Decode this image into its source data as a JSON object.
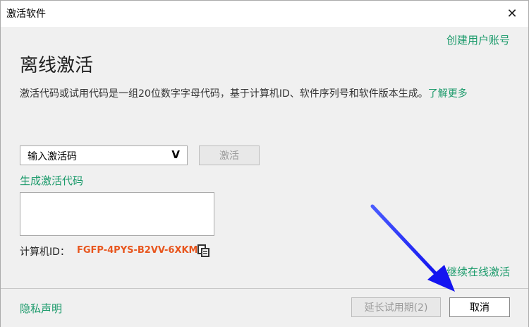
{
  "window": {
    "title": "激活软件",
    "close_glyph": "✕"
  },
  "header": {
    "create_account_link": "创建用户账号",
    "heading": "离线激活"
  },
  "description": {
    "text": "激活代码或试用代码是一组20位数字字母代码，基于计算机ID、软件序列号和软件版本生成。",
    "learn_more": "了解更多"
  },
  "activation": {
    "select_value": "输入激活码",
    "chevron": "V",
    "activate_label": "激活",
    "generate_link": "生成激活代码",
    "textarea_value": ""
  },
  "machine": {
    "label": "计算机ID：",
    "id": "FGFP-4PYS-B2VV-6XKM"
  },
  "continue_online_link": "继续在线激活",
  "footer": {
    "privacy_link": "隐私声明",
    "extend_label": "延长试用期(2)",
    "cancel_label": "取消"
  },
  "colors": {
    "accent_link": "#1a9a6a",
    "machine_id": "#e8561e",
    "arrow": "#1a1aff"
  },
  "icons": {
    "copy": "copy-icon",
    "close": "close-icon",
    "arrow": "arrow-annotation-icon"
  }
}
